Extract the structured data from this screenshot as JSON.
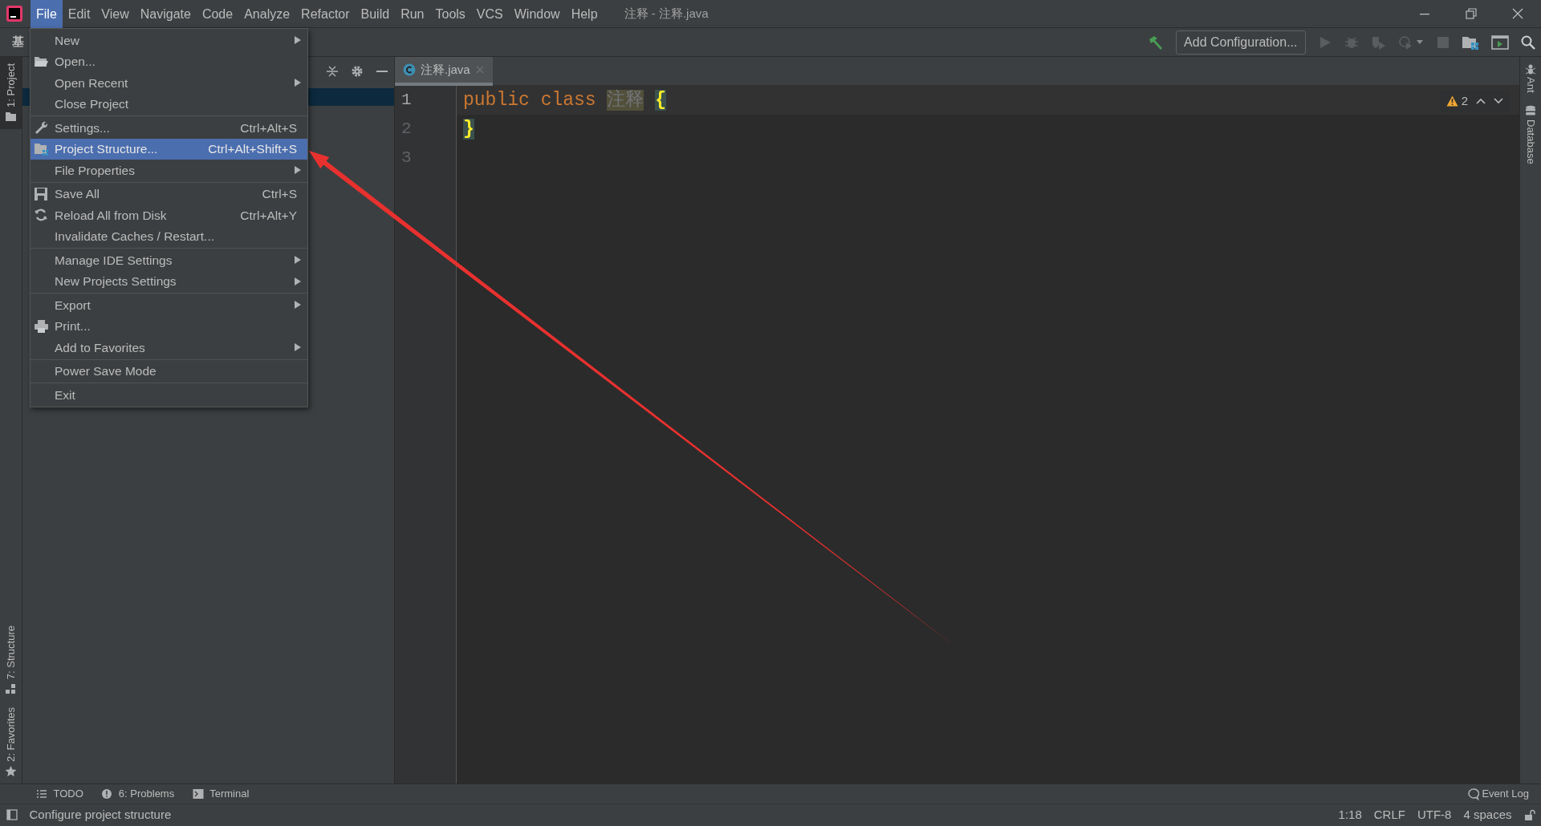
{
  "window": {
    "title": "注释 - 注释.java"
  },
  "menu_bar": [
    {
      "label": "File",
      "selected": true
    },
    {
      "label": "Edit",
      "selected": false
    },
    {
      "label": "View",
      "selected": false
    },
    {
      "label": "Navigate",
      "selected": false
    },
    {
      "label": "Code",
      "selected": false
    },
    {
      "label": "Analyze",
      "selected": false
    },
    {
      "label": "Refactor",
      "selected": false
    },
    {
      "label": "Build",
      "selected": false
    },
    {
      "label": "Run",
      "selected": false
    },
    {
      "label": "Tools",
      "selected": false
    },
    {
      "label": "VCS",
      "selected": false
    },
    {
      "label": "Window",
      "selected": false
    },
    {
      "label": "Help",
      "selected": false
    }
  ],
  "navigation_bar": {
    "breadcrumb": "基"
  },
  "toolbar": {
    "run_configuration": "Add Configuration..."
  },
  "left_tool_windows": [
    {
      "label": "1: Project",
      "selected": true
    },
    {
      "label": "7: Structure",
      "selected": false
    },
    {
      "label": "2: Favorites",
      "selected": false
    }
  ],
  "right_tool_windows": [
    {
      "label": "Ant"
    },
    {
      "label": "Database"
    }
  ],
  "editor": {
    "tabs": [
      {
        "label": "注释.java",
        "selected": true
      }
    ],
    "inspection_count": "2",
    "lines": [
      {
        "number": "1",
        "tokens": [
          {
            "text": "public",
            "kind": "keyword"
          },
          {
            "text": "class",
            "kind": "keyword"
          },
          {
            "text": "注释",
            "kind": "unused"
          },
          {
            "text": "{",
            "kind": "brace"
          }
        ]
      },
      {
        "number": "2",
        "tokens": [
          {
            "text": "}",
            "kind": "brace"
          }
        ]
      },
      {
        "number": "3"
      }
    ]
  },
  "file_menu": {
    "groups": [
      [
        {
          "label": "New",
          "submenu": true,
          "selected": false
        },
        {
          "label": "Open...",
          "submenu": false,
          "selected": false
        },
        {
          "label": "Open Recent",
          "submenu": true,
          "selected": false
        },
        {
          "label": "Close Project",
          "submenu": false,
          "selected": false
        }
      ],
      [
        {
          "label": "Settings...",
          "shortcut": "Ctrl+Alt+S",
          "submenu": false,
          "selected": false
        },
        {
          "label": "Project Structure...",
          "shortcut": "Ctrl+Alt+Shift+S",
          "submenu": false,
          "selected": true
        },
        {
          "label": "File Properties",
          "submenu": true,
          "selected": false
        }
      ],
      [
        {
          "label": "Save All",
          "shortcut": "Ctrl+S",
          "submenu": false,
          "selected": false
        },
        {
          "label": "Reload All from Disk",
          "shortcut": "Ctrl+Alt+Y",
          "submenu": false,
          "selected": false
        },
        {
          "label": "Invalidate Caches / Restart...",
          "submenu": false,
          "selected": false
        }
      ],
      [
        {
          "label": "Manage IDE Settings",
          "submenu": true,
          "selected": false
        },
        {
          "label": "New Projects Settings",
          "submenu": true,
          "selected": false
        }
      ],
      [
        {
          "label": "Export",
          "submenu": true,
          "selected": false
        },
        {
          "label": "Print...",
          "submenu": false,
          "selected": false
        },
        {
          "label": "Add to Favorites",
          "submenu": true,
          "selected": false
        }
      ],
      [
        {
          "label": "Power Save Mode",
          "submenu": false,
          "selected": false
        }
      ],
      [
        {
          "label": "Exit",
          "submenu": false,
          "selected": false
        }
      ]
    ]
  },
  "bottom_tool_windows": [
    {
      "label": "TODO"
    },
    {
      "label": "6: Problems"
    },
    {
      "label": "Terminal"
    }
  ],
  "event_log": "Event Log",
  "status_bar": {
    "message": "Configure project structure",
    "items": [
      "1:18",
      "CRLF",
      "UTF-8",
      "4 spaces"
    ]
  }
}
